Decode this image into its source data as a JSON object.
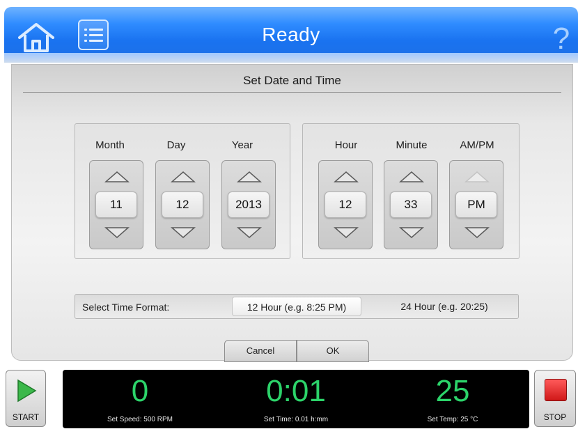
{
  "header": {
    "title": "Ready",
    "help_glyph": "?",
    "icons": [
      "home-icon",
      "list-menu-icon",
      "help-icon"
    ]
  },
  "dialog": {
    "title": "Set Date and Time",
    "date": {
      "month": {
        "label": "Month",
        "value": "11"
      },
      "day": {
        "label": "Day",
        "value": "12"
      },
      "year": {
        "label": "Year",
        "value": "2013"
      }
    },
    "time": {
      "hour": {
        "label": "Hour",
        "value": "12"
      },
      "minute": {
        "label": "Minute",
        "value": "33"
      },
      "ampm": {
        "label": "AM/PM",
        "value": "PM",
        "up_disabled": true
      }
    },
    "format": {
      "label": "Select Time Format:",
      "option_12": "12 Hour (e.g. 8:25 PM)",
      "option_24": "24 Hour (e.g. 20:25)",
      "selected": "12 Hour (e.g. 8:25 PM)"
    },
    "cancel_label": "Cancel",
    "ok_label": "OK"
  },
  "status_bar": {
    "start_label": "START",
    "stop_label": "STOP",
    "speed": {
      "value": "0",
      "sub": "Set Speed: 500 RPM"
    },
    "time": {
      "value": "0:01",
      "sub": "Set Time: 0.01 h:mm"
    },
    "temp": {
      "value": "25",
      "sub": "Set Temp: 25 °C"
    }
  },
  "colors": {
    "header_blue": "#1a73f0",
    "readout_green": "#2cd36a",
    "stop_red": "#e02020",
    "start_green": "#3bb84a"
  }
}
